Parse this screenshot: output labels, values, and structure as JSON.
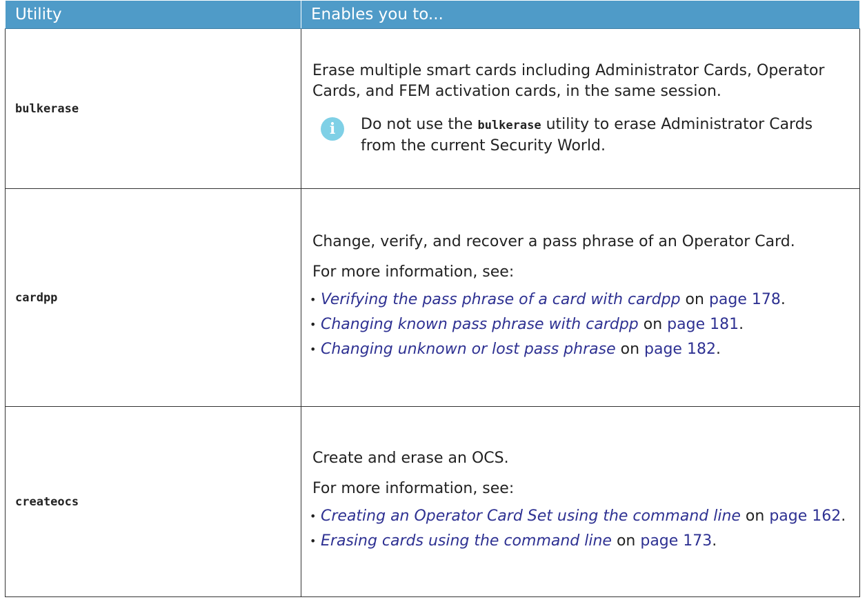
{
  "table": {
    "headers": [
      "Utility",
      "Enables you to..."
    ],
    "rows": [
      {
        "utility": "bulkerase",
        "description": "Erase multiple smart cards including Administrator Cards, Operator Cards, and FEM activation cards, in the same session.",
        "note": {
          "icon": "info-icon",
          "prefix": "Do not use the ",
          "code": "bulkerase",
          "suffix": " utility to erase Administrator Cards from the current Security World."
        }
      },
      {
        "utility": "cardpp",
        "description": "Change, verify, and recover a pass phrase of an Operator Card.",
        "more": "For more information, see:",
        "links": [
          {
            "title": "Verifying the pass phrase of a card with cardpp",
            "on": " on ",
            "page": "page 178",
            "end": "."
          },
          {
            "title": "Changing known pass phrase with cardpp",
            "on": " on ",
            "page": "page 181",
            "end": "."
          },
          {
            "title": "Changing unknown or lost pass phrase",
            "on": " on ",
            "page": "page 182",
            "end": "."
          }
        ]
      },
      {
        "utility": "createocs",
        "description": "Create and erase an OCS.",
        "more": "For more information, see:",
        "links": [
          {
            "title": "Creating an Operator Card Set using the command line",
            "on": " on ",
            "page": "page 162",
            "end": "."
          },
          {
            "title": "Erasing cards using the command line",
            "on": " on ",
            "page": "page 173",
            "end": "."
          }
        ]
      }
    ]
  },
  "colors": {
    "header_bg": "#4f9bc8",
    "link": "#2e3192",
    "info_icon": "#7fd0e6"
  }
}
